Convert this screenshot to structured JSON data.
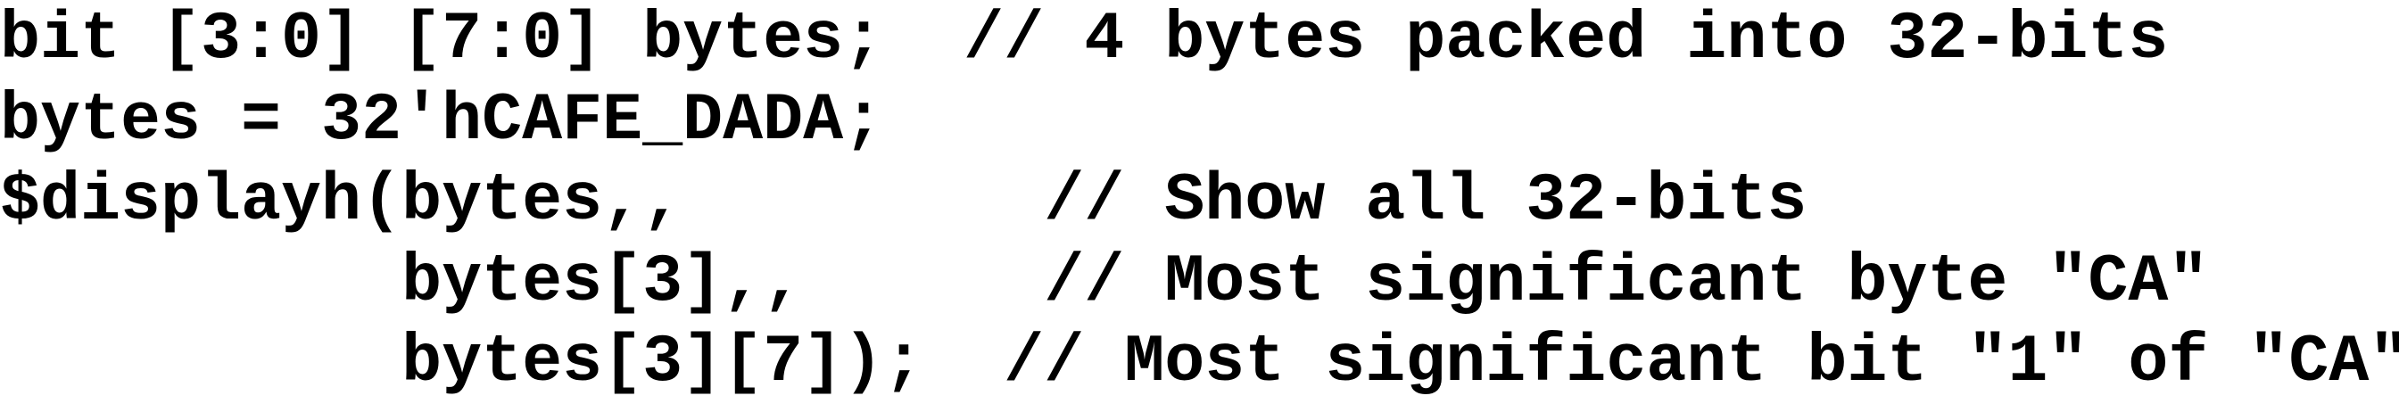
{
  "code": {
    "lines": [
      "bit [3:0] [7:0] bytes;  // 4 bytes packed into 32-bits",
      "bytes = 32'hCAFE_DADA;",
      "$displayh(bytes,,         // Show all 32-bits",
      "          bytes[3],,      // Most significant byte \"CA\"",
      "          bytes[3][7]);  // Most significant bit \"1\" of \"CA\""
    ]
  },
  "colors": {
    "background": "#ffffff",
    "text": "#000000"
  }
}
